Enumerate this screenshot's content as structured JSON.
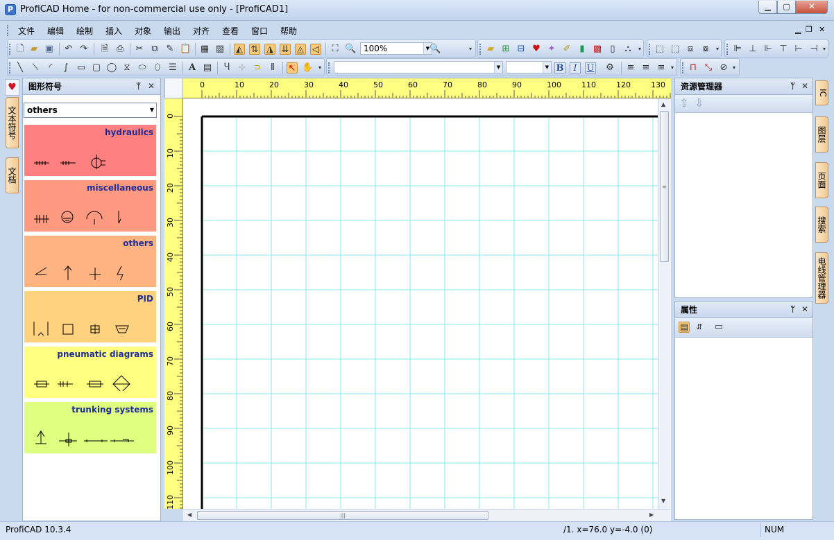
{
  "window": {
    "title": "ProfiCAD Home - for non-commercial use only - [ProfiCAD1]",
    "app_icon": "P",
    "min": "▁",
    "max": "▢",
    "close": "✕",
    "mdi_min": "▁",
    "mdi_restore": "❐",
    "mdi_close": "✕"
  },
  "menu": [
    "文件",
    "编辑",
    "绘制",
    "插入",
    "对象",
    "输出",
    "对齐",
    "查看",
    "窗口",
    "帮助"
  ],
  "toolbar": {
    "zoom": "100%",
    "font_name": "",
    "font_size": "",
    "bold": "B",
    "italic": "I",
    "underline": "U"
  },
  "left_panel": {
    "title": "图形符号",
    "pin": "ᛘ",
    "close": "✕",
    "select": "others",
    "categories": [
      {
        "name": "hydraulics",
        "color": "#ff8080"
      },
      {
        "name": "miscellaneous",
        "color": "#ff9980"
      },
      {
        "name": "others",
        "color": "#ffb380"
      },
      {
        "name": "PID",
        "color": "#ffd280"
      },
      {
        "name": "pneumatic diagrams",
        "color": "#ffff80"
      },
      {
        "name": "trunking systems",
        "color": "#dfff80"
      }
    ],
    "side_tabs": [
      {
        "label": "文本符号"
      },
      {
        "label": "文档"
      }
    ]
  },
  "ruler": {
    "h": [
      "0",
      "10",
      "20",
      "30",
      "40",
      "50",
      "60",
      "70",
      "80",
      "90",
      "100",
      "110",
      "120",
      "130"
    ],
    "v": [
      "0",
      "10",
      "20",
      "30",
      "40",
      "50",
      "60",
      "70",
      "80",
      "90",
      "100",
      "110"
    ]
  },
  "right_panels": {
    "explorer": {
      "title": "资源管理器",
      "pin": "ᛘ",
      "close": "✕"
    },
    "properties": {
      "title": "属性",
      "pin": "ᛘ",
      "close": "✕"
    }
  },
  "right_tabs": [
    {
      "label": "IC"
    },
    {
      "label": "图层"
    },
    {
      "label": "页面"
    },
    {
      "label": "搜索"
    },
    {
      "label": "电线管理器"
    }
  ],
  "status": {
    "version": "ProfiCAD 10.3.4",
    "coords": "/1.  x=76.0  y=-4.0 (0)",
    "num": "NUM"
  }
}
